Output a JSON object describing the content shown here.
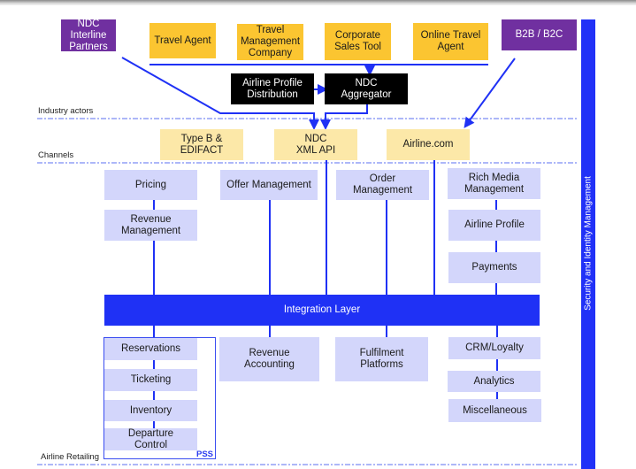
{
  "industry_actors": {
    "section_label": "Industry actors",
    "ndc_interline_partners": "NDC Interline\nPartners",
    "travel_agent": "Travel Agent",
    "travel_management_company": "Travel\nManagement\nCompany",
    "corporate_sales_tool": "Corporate\nSales Tool",
    "online_travel_agent": "Online Travel\nAgent",
    "b2b_b2c": "B2B / B2C",
    "airline_profile_distribution": "Airline Profile\nDistribution",
    "ndc_aggregator": "NDC\nAggregator"
  },
  "channels": {
    "section_label": "Channels",
    "type_b_edifact": "Type B &\nEDIFACT",
    "ndc_xml_api": "NDC\nXML API",
    "airline_com": "Airline.com"
  },
  "airline_retailing": {
    "section_label": "Airline Retailing",
    "pricing": "Pricing",
    "revenue_management": "Revenue\nManagement",
    "offer_management": "Offer Management",
    "order_management": "Order\nManagement",
    "rich_media_management": "Rich Media\nManagement",
    "airline_profile": "Airline Profile",
    "payments": "Payments",
    "integration_layer": "Integration Layer",
    "reservations": "Reservations",
    "ticketing": "Ticketing",
    "inventory": "Inventory",
    "departure_control": "Departure\nControl",
    "pss_label": "PSS",
    "revenue_accounting": "Revenue\nAccounting",
    "fulfilment_platforms": "Fulfilment\nPlatforms",
    "crm_loyalty": "CRM/Loyalty",
    "analytics": "Analytics",
    "miscellaneous": "Miscellaneous"
  },
  "security": {
    "label": "Security and Identity Management"
  },
  "colors": {
    "connector_blue": "#1f31f5",
    "actor_purple": "#7030a0",
    "actor_yellow": "#fbc531",
    "channel_cream": "#fce8a8",
    "system_lavender": "#d3d6fb"
  }
}
